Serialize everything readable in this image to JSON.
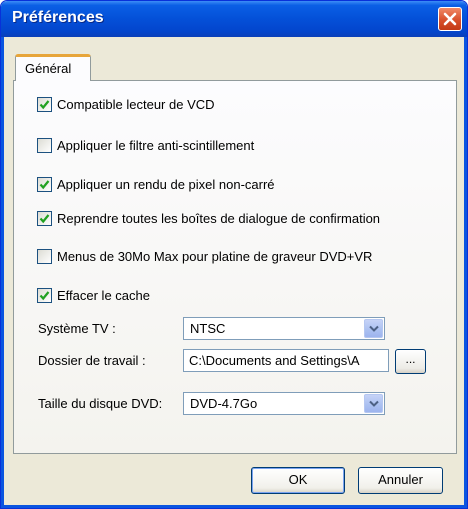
{
  "window": {
    "title": "Préférences"
  },
  "tabs": [
    {
      "label": "Général",
      "selected": true
    }
  ],
  "options": [
    {
      "label": "Compatible lecteur de VCD",
      "checked": true
    },
    {
      "label": "Appliquer le filtre anti-scintillement",
      "checked": false
    },
    {
      "label": "Appliquer un rendu de pixel non-carré",
      "checked": true
    },
    {
      "label": "Reprendre toutes les boîtes de dialogue de confirmation",
      "checked": true
    },
    {
      "label": "Menus de 30Mo Max pour platine de graveur DVD+VR",
      "checked": false
    },
    {
      "label": "Effacer le cache",
      "checked": true
    }
  ],
  "tv_system": {
    "label": "Système TV :",
    "value": "NTSC"
  },
  "work_folder": {
    "label": "Dossier de travail :",
    "value": "C:\\Documents and Settings\\A",
    "browse_label": "..."
  },
  "dvd_size": {
    "label": "Taille du disque DVD:",
    "value": "DVD-4.7Go"
  },
  "buttons": {
    "ok": "OK",
    "cancel": "Annuler"
  },
  "colors": {
    "title_bar": "#0450d8",
    "dialog_bg": "#ece9d8",
    "tab_accent": "#e7a53a",
    "close_button": "#d8502c",
    "check_mark": "#21a121"
  },
  "icons": {
    "close": "close-icon",
    "checkmark": "checkmark-icon",
    "dropdown": "chevron-down-icon"
  }
}
